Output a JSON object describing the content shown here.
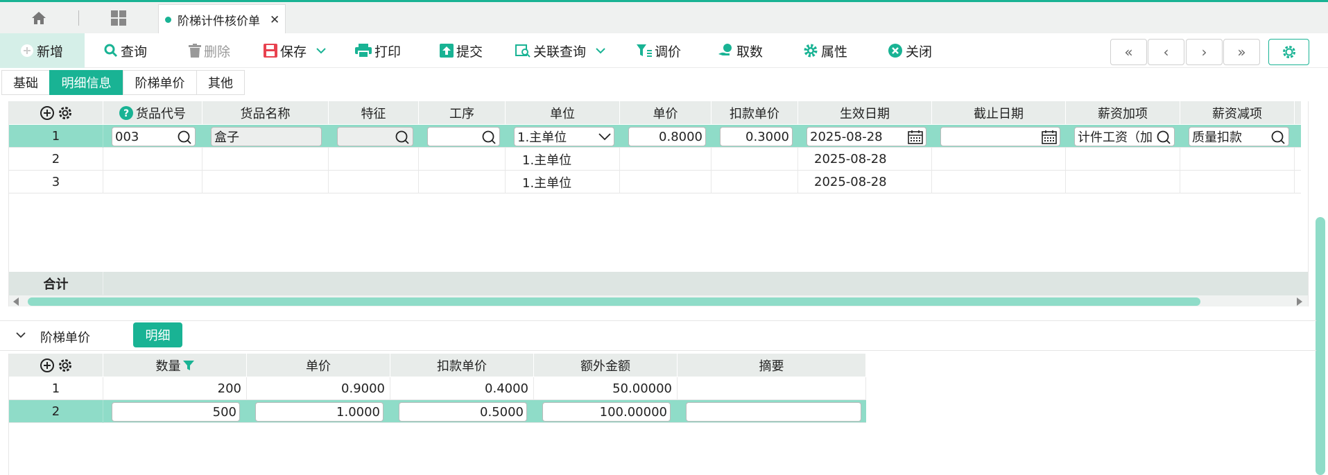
{
  "tabbar": {
    "active_tab": "阶梯计件核价单",
    "close": "✕"
  },
  "toolbar": {
    "new": "新增",
    "query": "查询",
    "delete": "删除",
    "save": "保存",
    "print": "打印",
    "submit": "提交",
    "related_query": "关联查询",
    "price_adjust": "调价",
    "fetch": "取数",
    "properties": "属性",
    "close": "关闭"
  },
  "nav": {
    "first": "«",
    "prev": "‹",
    "next": "›",
    "last": "»"
  },
  "subtabs": [
    "基础",
    "明细信息",
    "阶梯单价",
    "其他"
  ],
  "grid1": {
    "headers": [
      "货品代号",
      "货品名称",
      "特征",
      "工序",
      "单位",
      "单价",
      "扣款单价",
      "生效日期",
      "截止日期",
      "薪资加项",
      "薪资减项"
    ],
    "rows": [
      {
        "no": "1",
        "code": "003",
        "name": "盒子",
        "feature": "",
        "process": "",
        "unit": "1.主单位",
        "price": "0.8000",
        "deduct": "0.3000",
        "start": "2025-08-28",
        "end": "",
        "plus": "计件工资（加",
        "minus": "质量扣款"
      },
      {
        "no": "2",
        "unit": "1.主单位",
        "start": "2025-08-28"
      },
      {
        "no": "3",
        "unit": "1.主单位",
        "start": "2025-08-28"
      }
    ],
    "total_label": "合计"
  },
  "section2": {
    "title": "阶梯单价",
    "detail_button": "明细"
  },
  "grid2": {
    "headers": [
      "数量",
      "单价",
      "扣款单价",
      "额外金额",
      "摘要"
    ],
    "rows": [
      {
        "no": "1",
        "qty": "200",
        "price": "0.9000",
        "deduct": "0.4000",
        "extra": "50.00000",
        "memo": ""
      },
      {
        "no": "2",
        "qty": "500",
        "price": "1.0000",
        "deduct": "0.5000",
        "extra": "100.00000",
        "memo": ""
      }
    ]
  },
  "colors": {
    "accent": "#19b394",
    "row_selected": "#8fdcc8",
    "header_bg": "#e8ecea"
  }
}
